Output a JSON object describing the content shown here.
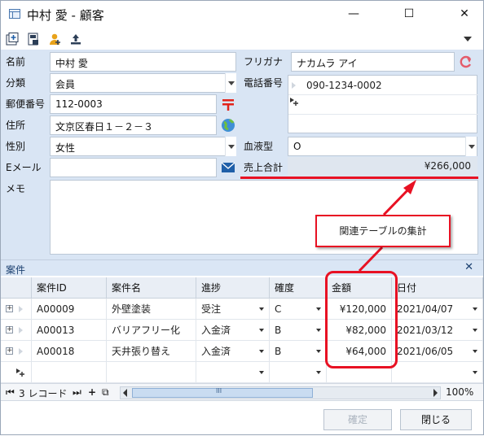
{
  "window": {
    "title": "中村 愛 - 顧客",
    "minimize": "—",
    "maximize": "☐",
    "close": "✕"
  },
  "form": {
    "name_label": "名前",
    "name_value": "中村 愛",
    "kana_label": "フリガナ",
    "kana_value": "ナカムラ アイ",
    "category_label": "分類",
    "category_value": "会員",
    "phone_label": "電話番号",
    "phone_value": "090-1234-0002",
    "zip_label": "郵便番号",
    "zip_value": "112-0003",
    "address_label": "住所",
    "address_value": "文京区春日１－２－３",
    "gender_label": "性別",
    "gender_value": "女性",
    "blood_label": "血液型",
    "blood_value": "O",
    "email_label": "Eメール",
    "email_value": "",
    "sales_total_label": "売上合計",
    "sales_total_value": "¥266,000",
    "memo_label": "メモ"
  },
  "annotation": {
    "callout_text": "関連テーブルの集計"
  },
  "subtable": {
    "title": "案件",
    "close": "✕",
    "columns": [
      "案件ID",
      "案件名",
      "進捗",
      "確度",
      "金額",
      "日付"
    ],
    "rows": [
      {
        "id": "A00009",
        "name": "外壁塗装",
        "status": "受注",
        "confidence": "C",
        "amount": "¥120,000",
        "date": "2021/04/07"
      },
      {
        "id": "A00013",
        "name": "バリアフリー化",
        "status": "入金済",
        "confidence": "B",
        "amount": "¥82,000",
        "date": "2021/03/12"
      },
      {
        "id": "A00018",
        "name": "天井張り替え",
        "status": "入金済",
        "confidence": "B",
        "amount": "¥64,000",
        "date": "2021/06/05"
      }
    ]
  },
  "navbar": {
    "first": "⏮",
    "record_count": "3 レコード",
    "last": "⏭",
    "add": "+",
    "copy": "⧉",
    "scroll_mid": "III",
    "zoom": "100%"
  },
  "footer": {
    "confirm_label": "確定",
    "close_label": "閉じる"
  },
  "colors": {
    "form_bg": "#d9e5f4",
    "annotation_red": "#e81123",
    "zip_icon": "#e2231a",
    "mail_icon": "#1f5fa8"
  }
}
